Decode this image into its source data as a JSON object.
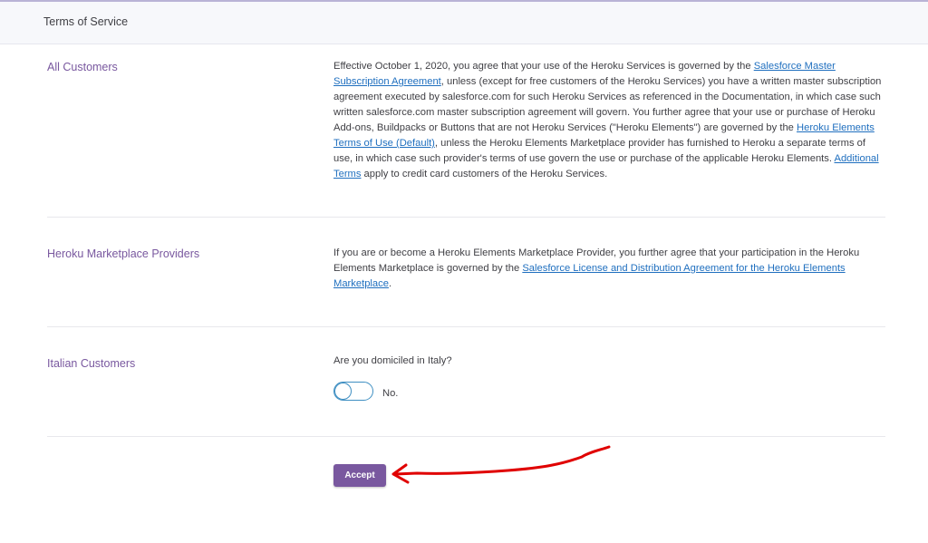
{
  "header": {
    "title": "Terms of Service"
  },
  "sections": [
    {
      "label": "All Customers",
      "text": {
        "t1": "Effective October 1, 2020, you agree that your use of the Heroku Services is governed by the ",
        "link1": "Salesforce Master Subscription Agreement",
        "t2": ", unless (except for free customers of the Heroku Services) you have a written master subscription agreement executed by salesforce.com for such Heroku Services as referenced in the Documentation, in which case such written salesforce.com master subscription agreement will govern. You further agree that your use or purchase of Heroku Add-ons, Buildpacks or Buttons that are not Heroku Services (\"Heroku Elements\") are governed by the ",
        "link2": "Heroku Elements Terms of Use (Default)",
        "t3": ", unless the Heroku Elements Marketplace provider has furnished to Heroku a separate terms of use, in which case such provider's terms of use govern the use or purchase of the applicable Heroku Elements. ",
        "link3": "Additional Terms",
        "t4": " apply to credit card customers of the Heroku Services."
      }
    },
    {
      "label": "Heroku Marketplace Providers",
      "text": {
        "t1": "If you are or become a Heroku Elements Marketplace Provider, you further agree that your participation in the Heroku Elements Marketplace is governed by the ",
        "link1": "Salesforce License and Distribution Agreement for the Heroku Elements Marketplace",
        "t2": "."
      }
    },
    {
      "label": "Italian Customers",
      "question": "Are you domiciled in Italy?",
      "toggle_label": "No."
    }
  ],
  "accept_label": "Accept",
  "colors": {
    "accent": "#79589f",
    "link": "#1f6fbf",
    "annotation_arrow": "#e00000"
  }
}
